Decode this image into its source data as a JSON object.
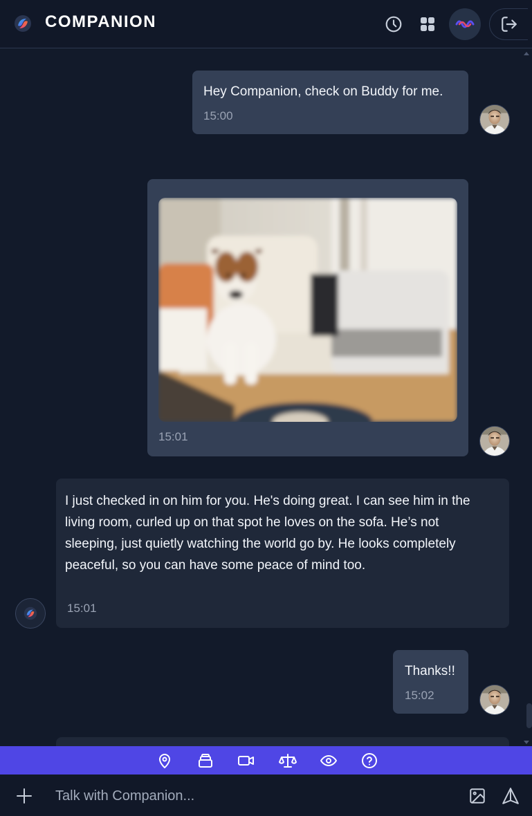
{
  "app": {
    "title": "COMPANION",
    "accent_color": "#4f46e5",
    "background_color": "#121a2a"
  },
  "header": {
    "buttons": [
      {
        "icon": "clock-icon"
      },
      {
        "icon": "grid-icon"
      },
      {
        "icon": "audio-wave-icon",
        "active": true
      },
      {
        "icon": "logout-icon"
      }
    ]
  },
  "messages": [
    {
      "sender": "user",
      "text": "Hey Companion, check on Buddy for me.",
      "time": "15:00"
    },
    {
      "sender": "user",
      "image": "Photo of a white and brown terrier sitting on a sofa",
      "time": "15:01"
    },
    {
      "sender": "companion",
      "lines": [
        "I just checked in on him for you. He's doing great. I can see him in the",
        "living room, curled up on that spot he loves on the sofa. He’s not",
        "sleeping, just quietly watching the world go by. He looks completely",
        "peaceful, so you can have some peace of mind too."
      ],
      "time": "15:01"
    },
    {
      "sender": "user",
      "text": "Thanks!!",
      "time": "15:02"
    }
  ],
  "toolbar": {
    "icons": [
      "location-pin-icon",
      "stack-icon",
      "video-camera-icon",
      "scale-icon",
      "eye-icon",
      "help-circle-icon"
    ]
  },
  "composer": {
    "placeholder": "Talk with Companion...",
    "icons": [
      "plus-icon",
      "image-icon",
      "send-icon"
    ]
  }
}
